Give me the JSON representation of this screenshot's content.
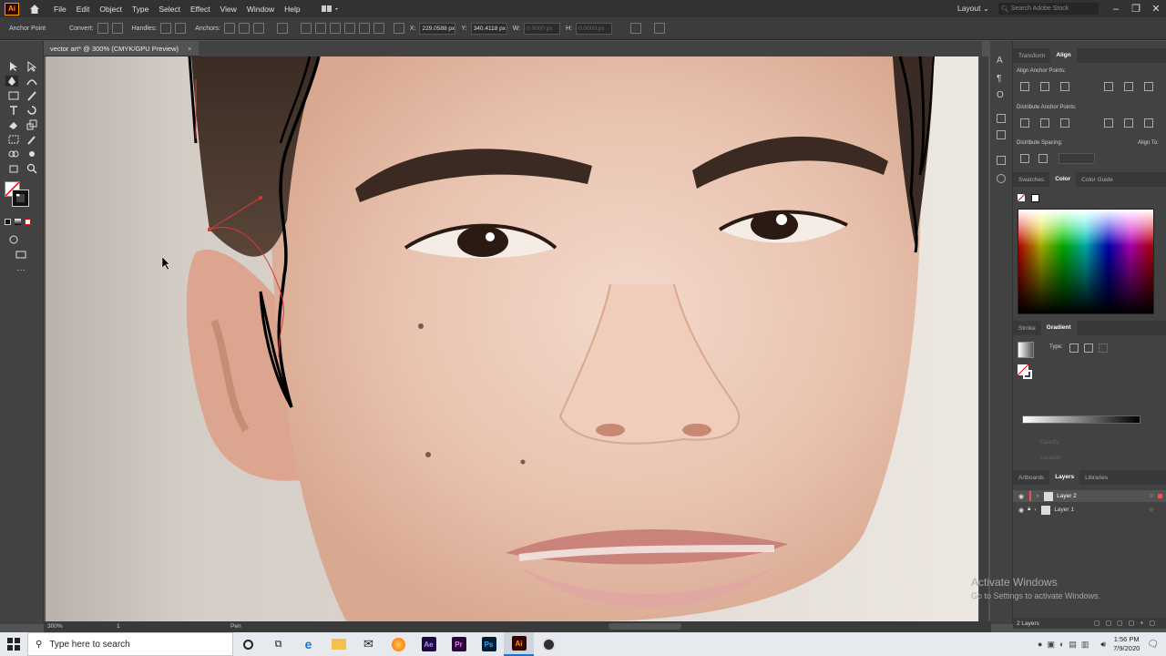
{
  "app": {
    "logo": "Ai",
    "brand_color": "#ff9a00"
  },
  "menubar": {
    "items": [
      "File",
      "Edit",
      "Object",
      "Type",
      "Select",
      "Effect",
      "View",
      "Window",
      "Help"
    ],
    "workspace": "Layout",
    "search_placeholder": "Search Adobe Stock"
  },
  "controlbar": {
    "tool_name": "Anchor Point",
    "convert": "Convert:",
    "handles": "Handles:",
    "anchors": "Anchors:",
    "x_label": "X:",
    "x_value": "229.0588 px",
    "y_label": "Y:",
    "y_value": "340.4118 px",
    "w_label": "W:",
    "w_value": "0.0000 px",
    "h_label": "H:",
    "h_value": "0.0000 px"
  },
  "document": {
    "tab_title": "vector art* @ 300% (CMYK/GPU Preview)",
    "close": "×"
  },
  "right_panel": {
    "tabs1": [
      "Transform",
      "Align"
    ],
    "align_anchor_points": "Align Anchor Points:",
    "distribute_anchor_points": "Distribute Anchor Points:",
    "distribute_spacing": "Distribute Spacing:",
    "align_to": "Align To:",
    "tabs2": [
      "Swatches",
      "Color",
      "Color Guide"
    ],
    "tabs3": [
      "Stroke",
      "Gradient"
    ],
    "gradient_type": "Type:",
    "opacity": "Opacity",
    "location": "Location",
    "tabs4": [
      "Artboards",
      "Layers",
      "Libraries"
    ],
    "layers": [
      "Layer 2",
      "Layer 1"
    ],
    "layer_count": "2 Layers",
    "selected_layer_color": "#4b6fbf"
  },
  "statusbar": {
    "zoom": "300%",
    "artboard": "1",
    "tool": "Pen"
  },
  "taskbar": {
    "search_placeholder": "Type here to search",
    "time": "1:56 PM",
    "date": "7/9/2020",
    "apps": [
      "Ae",
      "Pr",
      "Ps",
      "Ai"
    ]
  },
  "watermark": {
    "line1": "Activate Windows",
    "line2": "Go to Settings to activate Windows."
  }
}
